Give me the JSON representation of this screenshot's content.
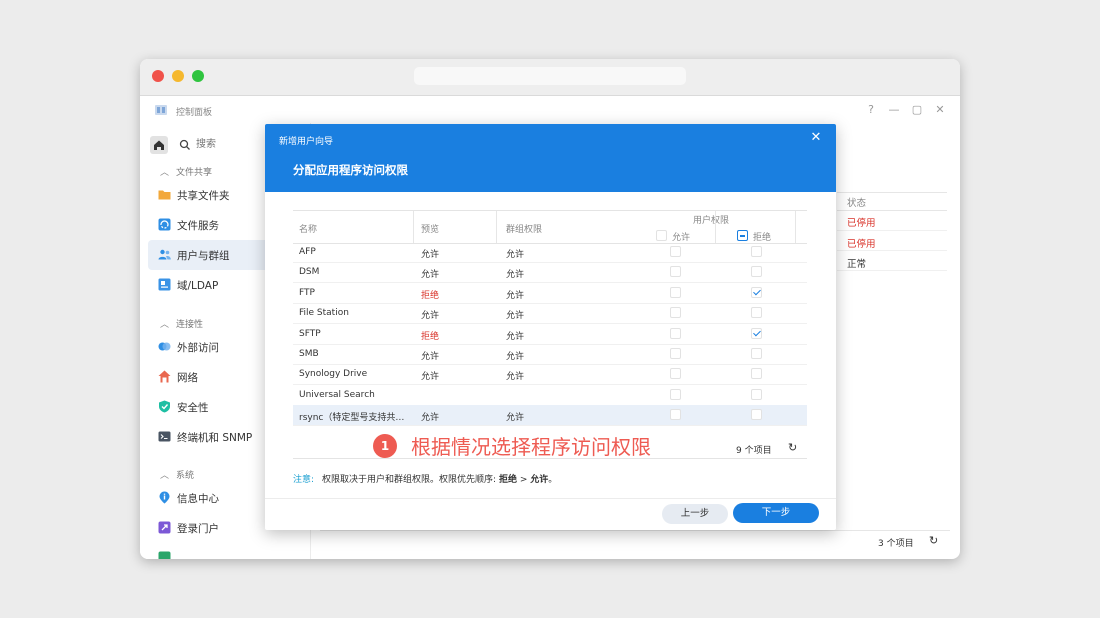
{
  "app": {
    "title": "控制面板",
    "window_controls": [
      "?",
      "—",
      "▢",
      "✕"
    ]
  },
  "sidebar": {
    "search_placeholder": "搜索",
    "sections": [
      {
        "label": "文件共享",
        "items": [
          {
            "label": "共享文件夹",
            "icon": "folder-icon"
          },
          {
            "label": "文件服务",
            "icon": "file-services-icon"
          },
          {
            "label": "用户与群组",
            "icon": "users-icon",
            "active": true
          },
          {
            "label": "域/LDAP",
            "icon": "domain-icon"
          }
        ]
      },
      {
        "label": "连接性",
        "items": [
          {
            "label": "外部访问",
            "icon": "external-access-icon"
          },
          {
            "label": "网络",
            "icon": "network-icon"
          },
          {
            "label": "安全性",
            "icon": "shield-icon"
          },
          {
            "label": "终端机和 SNMP",
            "icon": "terminal-icon"
          }
        ]
      },
      {
        "label": "系统",
        "items": [
          {
            "label": "信息中心",
            "icon": "info-icon"
          },
          {
            "label": "登录门户",
            "icon": "login-portal-icon"
          }
        ]
      }
    ]
  },
  "background_table": {
    "status_header": "状态",
    "rows": [
      {
        "status": "已停用",
        "color": "#d9342b"
      },
      {
        "status": "已停用",
        "color": "#d9342b"
      },
      {
        "status": "正常",
        "color": "#333333"
      }
    ],
    "count": "3 个项目"
  },
  "dialog": {
    "title": "新增用户向导",
    "subtitle": "分配应用程序访问权限",
    "columns": {
      "name": "名称",
      "preview": "预览",
      "group": "群组权限",
      "user_perm": "用户权限",
      "allow": "允许",
      "deny": "拒绝"
    },
    "rows": [
      {
        "name": "AFP",
        "preview": "允许",
        "group": "允许",
        "allow": false,
        "deny": false
      },
      {
        "name": "DSM",
        "preview": "允许",
        "group": "允许",
        "allow": false,
        "deny": false
      },
      {
        "name": "FTP",
        "preview": "拒绝",
        "group": "允许",
        "allow": false,
        "deny": true
      },
      {
        "name": "File Station",
        "preview": "允许",
        "group": "允许",
        "allow": false,
        "deny": false
      },
      {
        "name": "SFTP",
        "preview": "拒绝",
        "group": "允许",
        "allow": false,
        "deny": true
      },
      {
        "name": "SMB",
        "preview": "允许",
        "group": "允许",
        "allow": false,
        "deny": false
      },
      {
        "name": "Synology Drive",
        "preview": "允许",
        "group": "允许",
        "allow": false,
        "deny": false
      },
      {
        "name": "Universal Search",
        "preview": "",
        "group": "",
        "allow": false,
        "deny": false
      },
      {
        "name": "rsync（特定型号支持共…",
        "preview": "允许",
        "group": "允许",
        "allow": false,
        "deny": false,
        "highlight": true
      }
    ],
    "count": "9 个项目",
    "note_label": "注意:",
    "note_text": "权限取决于用户和群组权限。权限优先顺序:",
    "note_deny": "拒绝",
    "note_sep": ">",
    "note_allow": "允许",
    "note_end": "。",
    "prev_button": "上一步",
    "next_button": "下一步"
  },
  "annotation": {
    "number": "1",
    "text": "根据情况选择程序访问权限",
    "color": "#ee5b52"
  },
  "colors": {
    "accent": "#1a7fe0",
    "deny": "#d9342b"
  }
}
